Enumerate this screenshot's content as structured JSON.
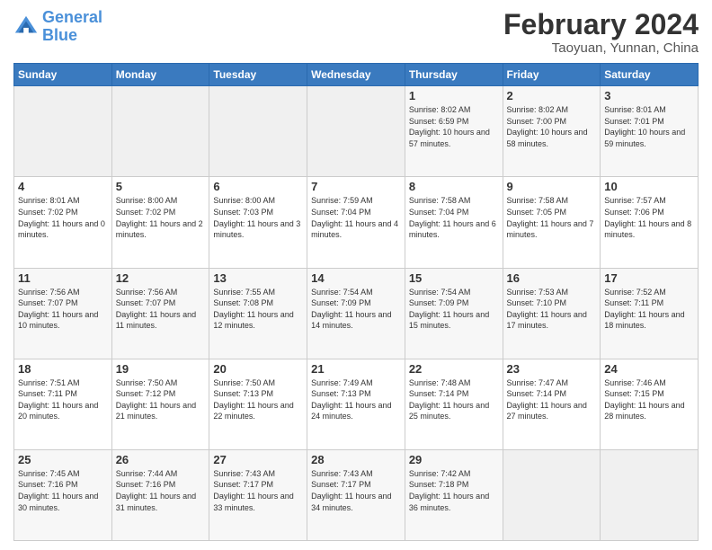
{
  "header": {
    "logo_line1": "General",
    "logo_line2": "Blue",
    "month_year": "February 2024",
    "location": "Taoyuan, Yunnan, China"
  },
  "days_of_week": [
    "Sunday",
    "Monday",
    "Tuesday",
    "Wednesday",
    "Thursday",
    "Friday",
    "Saturday"
  ],
  "weeks": [
    [
      {
        "day": "",
        "info": ""
      },
      {
        "day": "",
        "info": ""
      },
      {
        "day": "",
        "info": ""
      },
      {
        "day": "",
        "info": ""
      },
      {
        "day": "1",
        "info": "Sunrise: 8:02 AM\nSunset: 6:59 PM\nDaylight: 10 hours\nand 57 minutes."
      },
      {
        "day": "2",
        "info": "Sunrise: 8:02 AM\nSunset: 7:00 PM\nDaylight: 10 hours\nand 58 minutes."
      },
      {
        "day": "3",
        "info": "Sunrise: 8:01 AM\nSunset: 7:01 PM\nDaylight: 10 hours\nand 59 minutes."
      }
    ],
    [
      {
        "day": "4",
        "info": "Sunrise: 8:01 AM\nSunset: 7:02 PM\nDaylight: 11 hours\nand 0 minutes."
      },
      {
        "day": "5",
        "info": "Sunrise: 8:00 AM\nSunset: 7:02 PM\nDaylight: 11 hours\nand 2 minutes."
      },
      {
        "day": "6",
        "info": "Sunrise: 8:00 AM\nSunset: 7:03 PM\nDaylight: 11 hours\nand 3 minutes."
      },
      {
        "day": "7",
        "info": "Sunrise: 7:59 AM\nSunset: 7:04 PM\nDaylight: 11 hours\nand 4 minutes."
      },
      {
        "day": "8",
        "info": "Sunrise: 7:58 AM\nSunset: 7:04 PM\nDaylight: 11 hours\nand 6 minutes."
      },
      {
        "day": "9",
        "info": "Sunrise: 7:58 AM\nSunset: 7:05 PM\nDaylight: 11 hours\nand 7 minutes."
      },
      {
        "day": "10",
        "info": "Sunrise: 7:57 AM\nSunset: 7:06 PM\nDaylight: 11 hours\nand 8 minutes."
      }
    ],
    [
      {
        "day": "11",
        "info": "Sunrise: 7:56 AM\nSunset: 7:07 PM\nDaylight: 11 hours\nand 10 minutes."
      },
      {
        "day": "12",
        "info": "Sunrise: 7:56 AM\nSunset: 7:07 PM\nDaylight: 11 hours\nand 11 minutes."
      },
      {
        "day": "13",
        "info": "Sunrise: 7:55 AM\nSunset: 7:08 PM\nDaylight: 11 hours\nand 12 minutes."
      },
      {
        "day": "14",
        "info": "Sunrise: 7:54 AM\nSunset: 7:09 PM\nDaylight: 11 hours\nand 14 minutes."
      },
      {
        "day": "15",
        "info": "Sunrise: 7:54 AM\nSunset: 7:09 PM\nDaylight: 11 hours\nand 15 minutes."
      },
      {
        "day": "16",
        "info": "Sunrise: 7:53 AM\nSunset: 7:10 PM\nDaylight: 11 hours\nand 17 minutes."
      },
      {
        "day": "17",
        "info": "Sunrise: 7:52 AM\nSunset: 7:11 PM\nDaylight: 11 hours\nand 18 minutes."
      }
    ],
    [
      {
        "day": "18",
        "info": "Sunrise: 7:51 AM\nSunset: 7:11 PM\nDaylight: 11 hours\nand 20 minutes."
      },
      {
        "day": "19",
        "info": "Sunrise: 7:50 AM\nSunset: 7:12 PM\nDaylight: 11 hours\nand 21 minutes."
      },
      {
        "day": "20",
        "info": "Sunrise: 7:50 AM\nSunset: 7:13 PM\nDaylight: 11 hours\nand 22 minutes."
      },
      {
        "day": "21",
        "info": "Sunrise: 7:49 AM\nSunset: 7:13 PM\nDaylight: 11 hours\nand 24 minutes."
      },
      {
        "day": "22",
        "info": "Sunrise: 7:48 AM\nSunset: 7:14 PM\nDaylight: 11 hours\nand 25 minutes."
      },
      {
        "day": "23",
        "info": "Sunrise: 7:47 AM\nSunset: 7:14 PM\nDaylight: 11 hours\nand 27 minutes."
      },
      {
        "day": "24",
        "info": "Sunrise: 7:46 AM\nSunset: 7:15 PM\nDaylight: 11 hours\nand 28 minutes."
      }
    ],
    [
      {
        "day": "25",
        "info": "Sunrise: 7:45 AM\nSunset: 7:16 PM\nDaylight: 11 hours\nand 30 minutes."
      },
      {
        "day": "26",
        "info": "Sunrise: 7:44 AM\nSunset: 7:16 PM\nDaylight: 11 hours\nand 31 minutes."
      },
      {
        "day": "27",
        "info": "Sunrise: 7:43 AM\nSunset: 7:17 PM\nDaylight: 11 hours\nand 33 minutes."
      },
      {
        "day": "28",
        "info": "Sunrise: 7:43 AM\nSunset: 7:17 PM\nDaylight: 11 hours\nand 34 minutes."
      },
      {
        "day": "29",
        "info": "Sunrise: 7:42 AM\nSunset: 7:18 PM\nDaylight: 11 hours\nand 36 minutes."
      },
      {
        "day": "",
        "info": ""
      },
      {
        "day": "",
        "info": ""
      }
    ]
  ]
}
